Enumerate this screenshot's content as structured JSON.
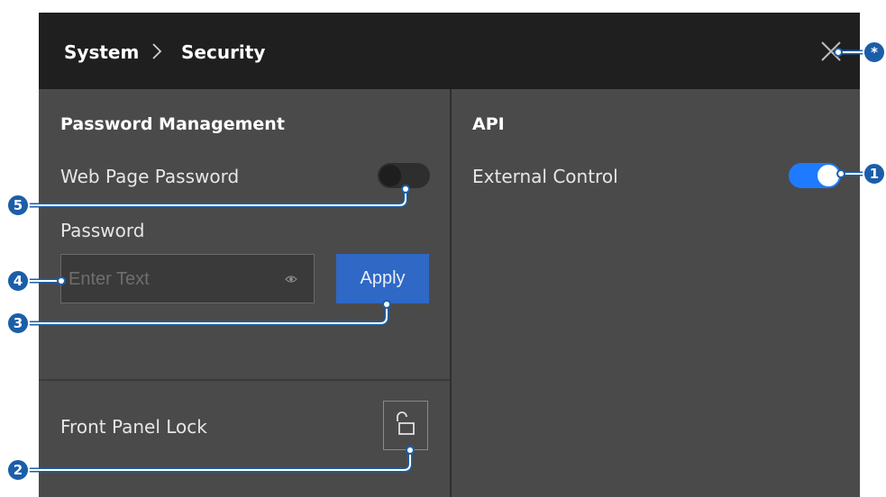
{
  "header": {
    "breadcrumb": [
      "System",
      "Security"
    ],
    "close_icon": "close-icon",
    "chevron_icon": "chevron-right-icon"
  },
  "password_management": {
    "title": "Password Management",
    "web_page_password_label": "Web Page Password",
    "web_page_password_enabled": false,
    "password_label": "Password",
    "password_placeholder": "Enter Text",
    "password_value": "",
    "eye_icon": "eye-icon",
    "apply_label": "Apply"
  },
  "front_panel": {
    "label": "Front Panel Lock",
    "icon": "unlocked-padlock-icon",
    "locked": false
  },
  "api": {
    "title": "API",
    "external_control_label": "External Control",
    "external_control_enabled": true
  },
  "callouts": [
    "*",
    "1",
    "2",
    "3",
    "4",
    "5"
  ],
  "colors": {
    "accent": "#2f68c5",
    "toggle_on": "#1e7bff",
    "callout": "#1b5ea8",
    "header_bg": "#1f1f1f",
    "panel_bg": "#4a4a4a"
  }
}
